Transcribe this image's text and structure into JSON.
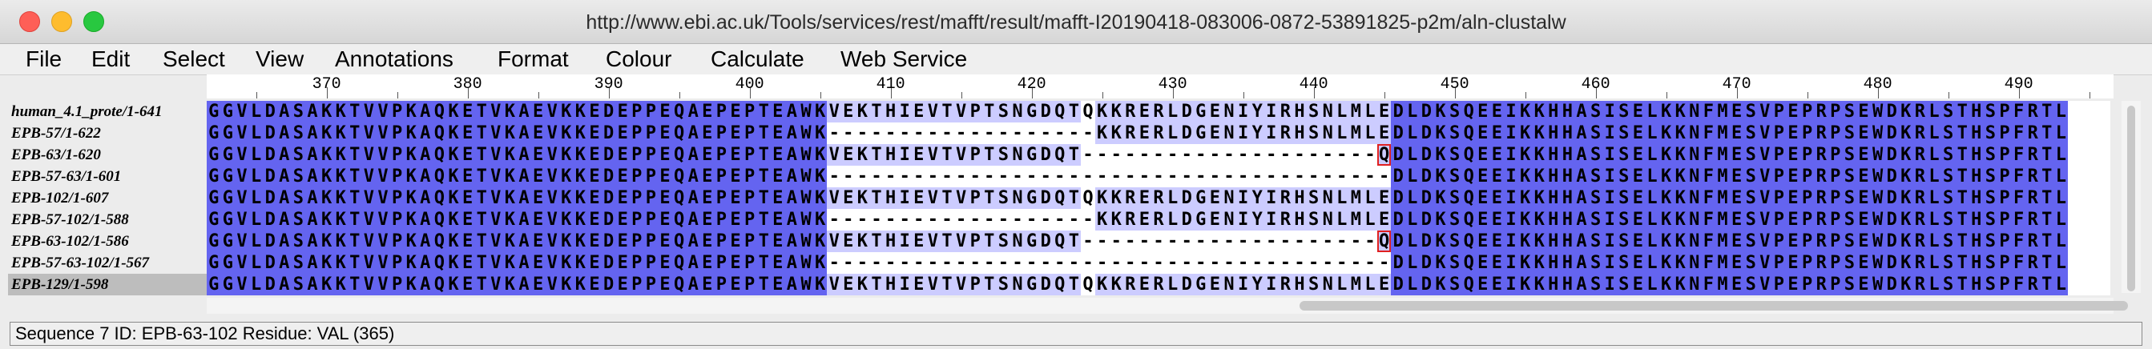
{
  "window": {
    "title": "http://www.ebi.ac.uk/Tools/services/rest/mafft/result/mafft-I20190418-083006-0872-53891825-p2m/aln-clustalw"
  },
  "menu": [
    "File",
    "Edit",
    "Select",
    "View",
    "Annotations",
    "Format",
    "Colour",
    "Calculate",
    "Web Service"
  ],
  "ruler": {
    "labels": [
      "370",
      "380",
      "390",
      "400",
      "410",
      "420",
      "430",
      "440",
      "450",
      "460",
      "470",
      "480",
      "490"
    ]
  },
  "sequences": [
    {
      "name": "human_4.1_prote/1-641",
      "residues": "GGVLDASAKKTVVPKAQKETVKAEVKKEDEPPEQAEPEPTEAWKVEKTHIEVTVPTSNGDQTQKKRERLDGENIYIRHSNLMLEDLDKSQEEIKKHHASISELKKNFMESVPEPRPSEWDKRLSTHSPFRTL"
    },
    {
      "name": "EPB-57/1-622",
      "residues": "GGVLDASAKKTVVPKAQKETVKAEVKKEDEPPEQAEPEPTEAWK-------------------KKRERLDGENIYIRHSNLMLEDLDKSQEEIKKHHASISELKKNFMESVPEPRPSEWDKRLSTHSPFRTL"
    },
    {
      "name": "EPB-63/1-620",
      "residues": "GGVLDASAKKTVVPKAQKETVKAEVKKEDEPPEQAEPEPTEAWKVEKTHIEVTVPTSNGDQT---------------------QDLDKSQEEIKKHHASISELKKNFMESVPEPRPSEWDKRLSTHSPFRTL"
    },
    {
      "name": "EPB-57-63/1-601",
      "residues": "GGVLDASAKKTVVPKAQKETVKAEVKKEDEPPEQAEPEPTEAWK----------------------------------------DLDKSQEEIKKHHASISELKKNFMESVPEPRPSEWDKRLSTHSPFRTL"
    },
    {
      "name": "EPB-102/1-607",
      "residues": "GGVLDASAKKTVVPKAQKETVKAEVKKEDEPPEQAEPEPTEAWKVEKTHIEVTVPTSNGDQTQKKRERLDGENIYIRHSNLMLEDLDKSQEEIKKHHASISELKKNFMESVPEPRPSEWDKRLSTHSPFRTL"
    },
    {
      "name": "EPB-57-102/1-588",
      "residues": "GGVLDASAKKTVVPKAQKETVKAEVKKEDEPPEQAEPEPTEAWK-------------------KKRERLDGENIYIRHSNLMLEDLDKSQEEIKKHHASISELKKNFMESVPEPRPSEWDKRLSTHSPFRTL"
    },
    {
      "name": "EPB-63-102/1-586",
      "residues": "GGVLDASAKKTVVPKAQKETVKAEVKKEDEPPEQAEPEPTEAWKVEKTHIEVTVPTSNGDQT---------------------QDLDKSQEEIKKHHASISELKKNFMESVPEPRPSEWDKRLSTHSPFRTL"
    },
    {
      "name": "EPB-57-63-102/1-567",
      "residues": "GGVLDASAKKTVVPKAQKETVKAEVKKEDEPPEQAEPEPTEAWK----------------------------------------DLDKSQEEIKKHHASISELKKNFMESVPEPRPSEWDKRLSTHSPFRTL"
    },
    {
      "name": "EPB-129/1-598",
      "residues": "GGVLDASAKKTVVPKAQKETVKAEVKKEDEPPEQAEPEPTEAWKVEKTHIEVTVPTSNGDQTQKKRERLDGENIYIRHSNLMLEDLDKSQEEIKKHHASISELKKNFMESVPEPRPSEWDKRLSTHSPFRTL",
      "selected": true
    }
  ],
  "colours": {
    "high": "#6464f0",
    "mid": "#a6a6f0",
    "low": "#ccccff",
    "none": "#ffffff",
    "marker": "#e02020"
  },
  "status": {
    "text": "Sequence 7 ID: EPB-63-102 Residue: VAL (365)"
  }
}
